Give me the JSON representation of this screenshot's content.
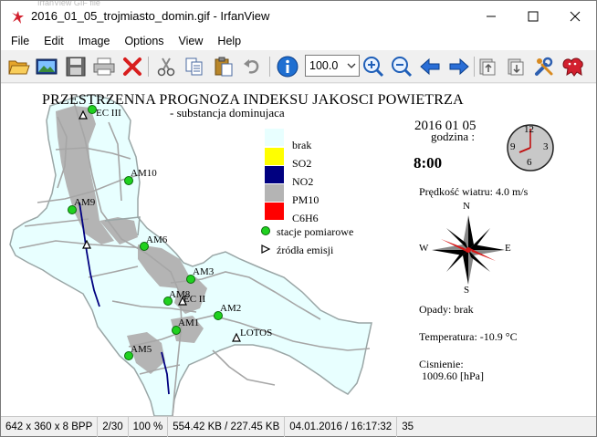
{
  "window": {
    "title": "2016_01_05_trojmiasto_domin.gif - IrfanView",
    "ghost": "IrfanView GIF file"
  },
  "menu": [
    "File",
    "Edit",
    "Image",
    "Options",
    "View",
    "Help"
  ],
  "toolbar": {
    "zoom_value": "100.0",
    "icons": [
      "open-folder-icon",
      "slideshow-icon",
      "save-icon",
      "print-icon",
      "delete-icon",
      "cut-icon",
      "copy-icon",
      "paste-icon",
      "undo-icon",
      "info-icon",
      "zoom-in-icon",
      "zoom-out-icon",
      "previous-icon",
      "next-icon",
      "copy-page-icon",
      "move-page-icon",
      "settings-icon",
      "irfanview-logo-icon"
    ]
  },
  "map": {
    "title": "PRZESTRZENNA PROGNOZA INDEKSU JAKOSCI POWIETRZA",
    "subtitle": "- substancja dominujaca",
    "date": "2016 01 05",
    "hour_label": "godzina :",
    "time": "8:00",
    "wind": "Prędkość wiatru: 4.0 m/s",
    "rain": "Opady: brak",
    "temperature": "Temperatura: -10.9 °C",
    "pressure_label": "Cisnienie:",
    "pressure_value": "1009.60 [hPa]",
    "compass": {
      "n": "N",
      "s": "S",
      "e": "E",
      "w": "W"
    },
    "clock": {
      "n12": "12",
      "n3": "3",
      "n6": "6",
      "n9": "9"
    },
    "legend": [
      {
        "label": "brak",
        "color": "#e8ffff"
      },
      {
        "label": "SO2",
        "color": "#ffff00"
      },
      {
        "label": "NO2",
        "color": "#000080"
      },
      {
        "label": "PM10",
        "color": "#b4b4b4"
      },
      {
        "label": "C6H6",
        "color": "#ff0000"
      }
    ],
    "legend_stations": "stacje pomiarowe",
    "legend_sources": "źródła emisji",
    "stations": [
      "AM10",
      "AM9",
      "AM6",
      "AM3",
      "AM8",
      "AM2",
      "AM1",
      "AM5"
    ],
    "sources": [
      "EC III",
      "EC II",
      "LOTOS"
    ]
  },
  "status": {
    "dims": "642 x 360 x 8 BPP",
    "index": "2/30",
    "zoom": "100 %",
    "size": "554.42 KB / 227.45 KB",
    "datetime": "04.01.2016 / 16:17:32",
    "extra": "35"
  }
}
